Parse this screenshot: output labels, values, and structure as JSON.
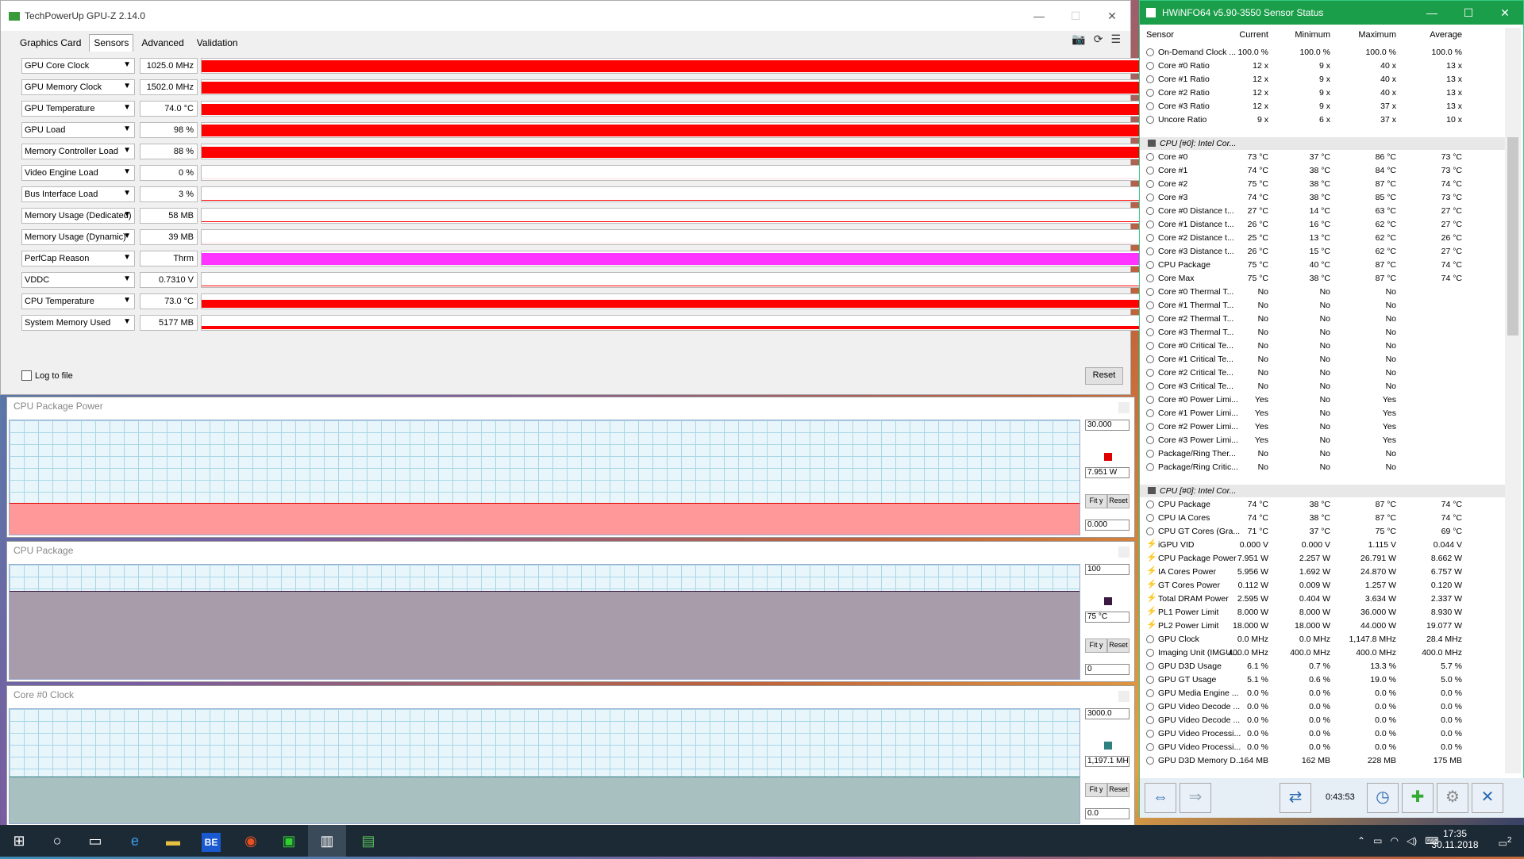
{
  "gpuz": {
    "title": "TechPowerUp GPU-Z 2.14.0",
    "tabs": [
      "Graphics Card",
      "Sensors",
      "Advanced",
      "Validation"
    ],
    "sensors": [
      {
        "name": "GPU Core Clock",
        "value": "1025.0 MHz",
        "color": "#ff0000",
        "level": 0.9
      },
      {
        "name": "GPU Memory Clock",
        "value": "1502.0 MHz",
        "color": "#ff0000",
        "level": 0.9
      },
      {
        "name": "GPU Temperature",
        "value": "74.0 °C",
        "color": "#ff0000",
        "level": 0.85
      },
      {
        "name": "GPU Load",
        "value": "98 %",
        "color": "#ff0000",
        "level": 0.9
      },
      {
        "name": "Memory Controller Load",
        "value": "88 %",
        "color": "#ff0000",
        "level": 0.85
      },
      {
        "name": "Video Engine Load",
        "value": "0 %",
        "color": "#ff0000",
        "level": 0
      },
      {
        "name": "Bus Interface Load",
        "value": "3 %",
        "color": "#ff0000",
        "level": 0.05
      },
      {
        "name": "Memory Usage (Dedicated)",
        "value": "58 MB",
        "color": "#ff0000",
        "level": 0.05
      },
      {
        "name": "Memory Usage (Dynamic)",
        "value": "39 MB",
        "color": "#ff0000",
        "level": 0.0
      },
      {
        "name": "PerfCap Reason",
        "value": "Thrm",
        "color": "#ff33ff",
        "level": 0.9
      },
      {
        "name": "VDDC",
        "value": "0.7310 V",
        "color": "#ff0000",
        "level": 0.05
      },
      {
        "name": "CPU Temperature",
        "value": "73.0 °C",
        "color": "#ff0000",
        "level": 0.6
      },
      {
        "name": "System Memory Used",
        "value": "5177 MB",
        "color": "#ff0000",
        "level": 0.25
      }
    ],
    "log_label": "Log to file",
    "reset_label": "Reset"
  },
  "graphs": [
    {
      "title": "CPU Package Power",
      "max": "30.000",
      "current": "7.951 W",
      "min": "0.000",
      "color": "#ff9999",
      "swatch": "#e00000",
      "level": 0.265,
      "fit": "Fit y",
      "reset": "Reset"
    },
    {
      "title": "CPU Package",
      "max": "100",
      "current": "75 °C",
      "min": "0",
      "color": "#a89cab",
      "swatch": "#3a1a40",
      "level": 0.75,
      "fit": "Fit y",
      "reset": "Reset"
    },
    {
      "title": "Core #0 Clock",
      "max": "3000.0",
      "current": "1,197.1 MH",
      "min": "0.0",
      "color": "#a9c0c0",
      "swatch": "#2f8080",
      "level": 0.4,
      "fit": "Fit y",
      "reset": "Reset"
    }
  ],
  "hwinfo": {
    "title": "HWiNFO64 v5.90-3550 Sensor Status",
    "columns": [
      "Sensor",
      "Current",
      "Minimum",
      "Maximum",
      "Average"
    ],
    "rows": [
      {
        "type": "row",
        "icon": "circle",
        "n": "On-Demand Clock ...",
        "c": "100.0 %",
        "mi": "100.0 %",
        "ma": "100.0 %",
        "a": "100.0 %"
      },
      {
        "type": "row",
        "icon": "circle",
        "n": "Core #0 Ratio",
        "c": "12 x",
        "mi": "9 x",
        "ma": "40 x",
        "a": "13 x"
      },
      {
        "type": "row",
        "icon": "circle",
        "n": "Core #1 Ratio",
        "c": "12 x",
        "mi": "9 x",
        "ma": "40 x",
        "a": "13 x"
      },
      {
        "type": "row",
        "icon": "circle",
        "n": "Core #2 Ratio",
        "c": "12 x",
        "mi": "9 x",
        "ma": "40 x",
        "a": "13 x"
      },
      {
        "type": "row",
        "icon": "circle",
        "n": "Core #3 Ratio",
        "c": "12 x",
        "mi": "9 x",
        "ma": "37 x",
        "a": "13 x"
      },
      {
        "type": "row",
        "icon": "circle",
        "n": "Uncore Ratio",
        "c": "9 x",
        "mi": "6 x",
        "ma": "37 x",
        "a": "10 x"
      },
      {
        "type": "blank"
      },
      {
        "type": "group",
        "n": "CPU [#0]: Intel Cor..."
      },
      {
        "type": "row",
        "icon": "circle",
        "n": "Core #0",
        "c": "73 °C",
        "mi": "37 °C",
        "ma": "86 °C",
        "a": "73 °C"
      },
      {
        "type": "row",
        "icon": "circle",
        "n": "Core #1",
        "c": "74 °C",
        "mi": "38 °C",
        "ma": "84 °C",
        "a": "73 °C"
      },
      {
        "type": "row",
        "icon": "circle",
        "n": "Core #2",
        "c": "75 °C",
        "mi": "38 °C",
        "ma": "87 °C",
        "a": "74 °C"
      },
      {
        "type": "row",
        "icon": "circle",
        "n": "Core #3",
        "c": "74 °C",
        "mi": "38 °C",
        "ma": "85 °C",
        "a": "73 °C"
      },
      {
        "type": "row",
        "icon": "circle",
        "n": "Core #0 Distance t...",
        "c": "27 °C",
        "mi": "14 °C",
        "ma": "63 °C",
        "a": "27 °C"
      },
      {
        "type": "row",
        "icon": "circle",
        "n": "Core #1 Distance t...",
        "c": "26 °C",
        "mi": "16 °C",
        "ma": "62 °C",
        "a": "27 °C"
      },
      {
        "type": "row",
        "icon": "circle",
        "n": "Core #2 Distance t...",
        "c": "25 °C",
        "mi": "13 °C",
        "ma": "62 °C",
        "a": "26 °C"
      },
      {
        "type": "row",
        "icon": "circle",
        "n": "Core #3 Distance t...",
        "c": "26 °C",
        "mi": "15 °C",
        "ma": "62 °C",
        "a": "27 °C"
      },
      {
        "type": "row",
        "icon": "circle",
        "n": "CPU Package",
        "c": "75 °C",
        "mi": "40 °C",
        "ma": "87 °C",
        "a": "74 °C"
      },
      {
        "type": "row",
        "icon": "circle",
        "n": "Core Max",
        "c": "75 °C",
        "mi": "38 °C",
        "ma": "87 °C",
        "a": "74 °C"
      },
      {
        "type": "row",
        "icon": "circle",
        "n": "Core #0 Thermal T...",
        "c": "No",
        "mi": "No",
        "ma": "No",
        "a": ""
      },
      {
        "type": "row",
        "icon": "circle",
        "n": "Core #1 Thermal T...",
        "c": "No",
        "mi": "No",
        "ma": "No",
        "a": ""
      },
      {
        "type": "row",
        "icon": "circle",
        "n": "Core #2 Thermal T...",
        "c": "No",
        "mi": "No",
        "ma": "No",
        "a": ""
      },
      {
        "type": "row",
        "icon": "circle",
        "n": "Core #3 Thermal T...",
        "c": "No",
        "mi": "No",
        "ma": "No",
        "a": ""
      },
      {
        "type": "row",
        "icon": "circle",
        "n": "Core #0 Critical Te...",
        "c": "No",
        "mi": "No",
        "ma": "No",
        "a": ""
      },
      {
        "type": "row",
        "icon": "circle",
        "n": "Core #1 Critical Te...",
        "c": "No",
        "mi": "No",
        "ma": "No",
        "a": ""
      },
      {
        "type": "row",
        "icon": "circle",
        "n": "Core #2 Critical Te...",
        "c": "No",
        "mi": "No",
        "ma": "No",
        "a": ""
      },
      {
        "type": "row",
        "icon": "circle",
        "n": "Core #3 Critical Te...",
        "c": "No",
        "mi": "No",
        "ma": "No",
        "a": ""
      },
      {
        "type": "row",
        "icon": "circle",
        "n": "Core #0 Power Limi...",
        "c": "Yes",
        "mi": "No",
        "ma": "Yes",
        "a": ""
      },
      {
        "type": "row",
        "icon": "circle",
        "n": "Core #1 Power Limi...",
        "c": "Yes",
        "mi": "No",
        "ma": "Yes",
        "a": ""
      },
      {
        "type": "row",
        "icon": "circle",
        "n": "Core #2 Power Limi...",
        "c": "Yes",
        "mi": "No",
        "ma": "Yes",
        "a": ""
      },
      {
        "type": "row",
        "icon": "circle",
        "n": "Core #3 Power Limi...",
        "c": "Yes",
        "mi": "No",
        "ma": "Yes",
        "a": ""
      },
      {
        "type": "row",
        "icon": "circle",
        "n": "Package/Ring Ther...",
        "c": "No",
        "mi": "No",
        "ma": "No",
        "a": ""
      },
      {
        "type": "row",
        "icon": "circle",
        "n": "Package/Ring Critic...",
        "c": "No",
        "mi": "No",
        "ma": "No",
        "a": ""
      },
      {
        "type": "blank"
      },
      {
        "type": "group",
        "n": "CPU [#0]: Intel Cor..."
      },
      {
        "type": "row",
        "icon": "circle",
        "n": "CPU Package",
        "c": "74 °C",
        "mi": "38 °C",
        "ma": "87 °C",
        "a": "74 °C"
      },
      {
        "type": "row",
        "icon": "circle",
        "n": "CPU IA Cores",
        "c": "74 °C",
        "mi": "38 °C",
        "ma": "87 °C",
        "a": "74 °C"
      },
      {
        "type": "row",
        "icon": "circle",
        "n": "CPU GT Cores (Gra...",
        "c": "71 °C",
        "mi": "37 °C",
        "ma": "75 °C",
        "a": "69 °C"
      },
      {
        "type": "row",
        "icon": "bolt",
        "n": "iGPU VID",
        "c": "0.000 V",
        "mi": "0.000 V",
        "ma": "1.115 V",
        "a": "0.044 V"
      },
      {
        "type": "row",
        "icon": "bolt",
        "n": "CPU Package Power",
        "c": "7.951 W",
        "mi": "2.257 W",
        "ma": "26.791 W",
        "a": "8.662 W"
      },
      {
        "type": "row",
        "icon": "bolt",
        "n": "IA Cores Power",
        "c": "5.956 W",
        "mi": "1.692 W",
        "ma": "24.870 W",
        "a": "6.757 W"
      },
      {
        "type": "row",
        "icon": "bolt",
        "n": "GT Cores Power",
        "c": "0.112 W",
        "mi": "0.009 W",
        "ma": "1.257 W",
        "a": "0.120 W"
      },
      {
        "type": "row",
        "icon": "bolt",
        "n": "Total DRAM Power",
        "c": "2.595 W",
        "mi": "0.404 W",
        "ma": "3.634 W",
        "a": "2.337 W"
      },
      {
        "type": "row",
        "icon": "bolt",
        "n": "PL1 Power Limit",
        "c": "8.000 W",
        "mi": "8.000 W",
        "ma": "36.000 W",
        "a": "8.930 W"
      },
      {
        "type": "row",
        "icon": "bolt",
        "n": "PL2 Power Limit",
        "c": "18.000 W",
        "mi": "18.000 W",
        "ma": "44.000 W",
        "a": "19.077 W"
      },
      {
        "type": "row",
        "icon": "circle",
        "n": "GPU Clock",
        "c": "0.0 MHz",
        "mi": "0.0 MHz",
        "ma": "1,147.8 MHz",
        "a": "28.4 MHz"
      },
      {
        "type": "row",
        "icon": "circle",
        "n": "Imaging Unit (IMGU...",
        "c": "400.0 MHz",
        "mi": "400.0 MHz",
        "ma": "400.0 MHz",
        "a": "400.0 MHz"
      },
      {
        "type": "row",
        "icon": "circle",
        "n": "GPU D3D Usage",
        "c": "6.1 %",
        "mi": "0.7 %",
        "ma": "13.3 %",
        "a": "5.7 %"
      },
      {
        "type": "row",
        "icon": "circle",
        "n": "GPU GT Usage",
        "c": "5.1 %",
        "mi": "0.6 %",
        "ma": "19.0 %",
        "a": "5.0 %"
      },
      {
        "type": "row",
        "icon": "circle",
        "n": "GPU Media Engine ...",
        "c": "0.0 %",
        "mi": "0.0 %",
        "ma": "0.0 %",
        "a": "0.0 %"
      },
      {
        "type": "row",
        "icon": "circle",
        "n": "GPU Video Decode ...",
        "c": "0.0 %",
        "mi": "0.0 %",
        "ma": "0.0 %",
        "a": "0.0 %"
      },
      {
        "type": "row",
        "icon": "circle",
        "n": "GPU Video Decode ...",
        "c": "0.0 %",
        "mi": "0.0 %",
        "ma": "0.0 %",
        "a": "0.0 %"
      },
      {
        "type": "row",
        "icon": "circle",
        "n": "GPU Video Processi...",
        "c": "0.0 %",
        "mi": "0.0 %",
        "ma": "0.0 %",
        "a": "0.0 %"
      },
      {
        "type": "row",
        "icon": "circle",
        "n": "GPU Video Processi...",
        "c": "0.0 %",
        "mi": "0.0 %",
        "ma": "0.0 %",
        "a": "0.0 %"
      },
      {
        "type": "row",
        "icon": "circle",
        "n": "GPU D3D Memory D...",
        "c": "164 MB",
        "mi": "162 MB",
        "ma": "228 MB",
        "a": "175 MB"
      }
    ],
    "elapsed": "0:43:53"
  },
  "taskbar": {
    "icons": [
      "start-icon",
      "search-icon",
      "task-view-icon",
      "edge-icon",
      "file-explorer-icon",
      "be-app-icon",
      "furmark-icon",
      "gpu-app-icon",
      "hwinfo-taskbar-icon",
      "gpuz-taskbar-icon"
    ],
    "be_label": "BE",
    "time": "17:35",
    "date": "30.11.2018",
    "notifications": "2"
  }
}
